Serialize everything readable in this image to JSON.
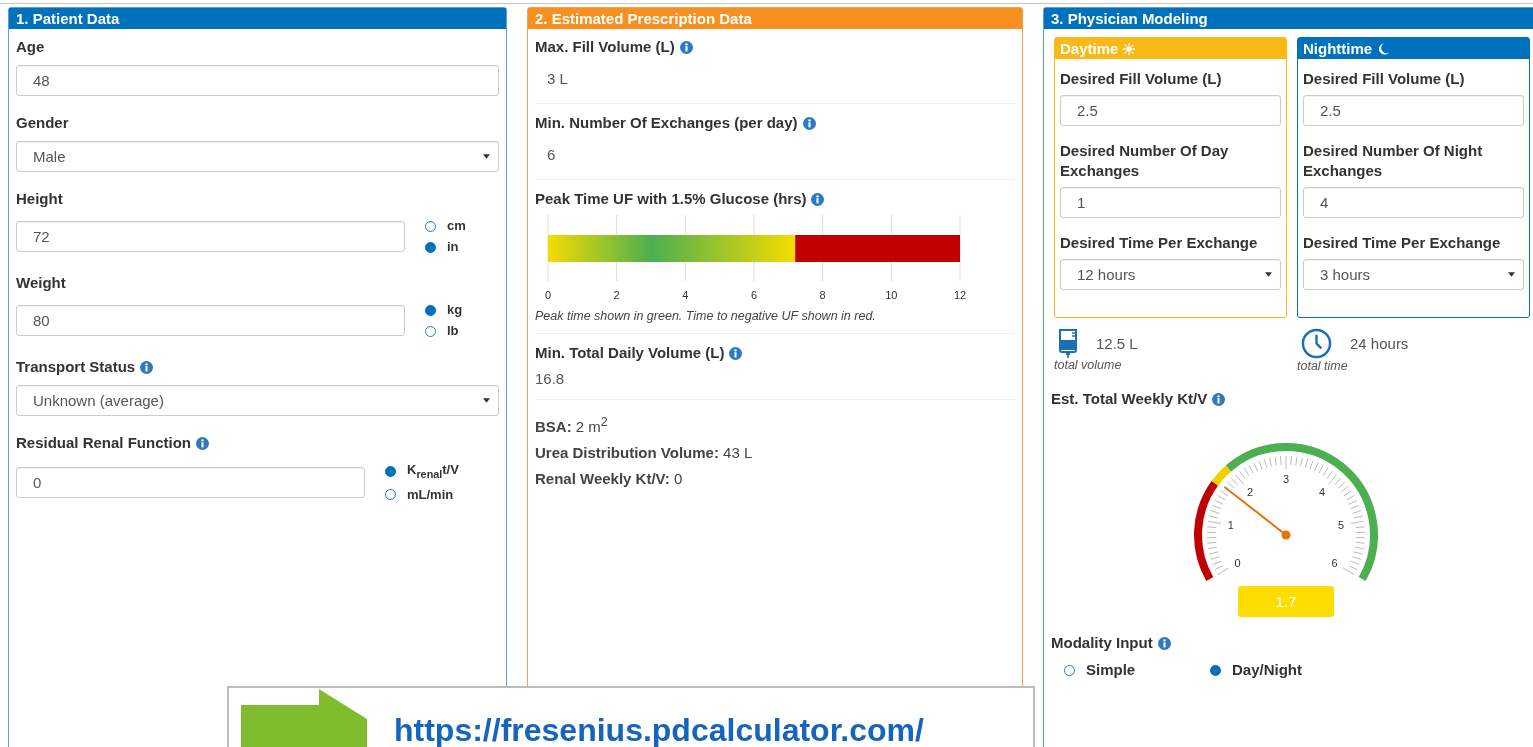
{
  "patient_data": {
    "title": "1. Patient Data",
    "fields": [
      {
        "kind": "input",
        "label": "Age",
        "info": false,
        "value": "48"
      },
      {
        "kind": "select",
        "label": "Gender",
        "info": false,
        "value": "Male"
      },
      {
        "kind": "input",
        "label": "Height",
        "info": false,
        "value": "72",
        "units": [
          {
            "label": "cm",
            "selected": false
          },
          {
            "label": "in",
            "selected": true
          }
        ]
      },
      {
        "kind": "input",
        "label": "Weight",
        "info": false,
        "value": "80",
        "units": [
          {
            "label": "kg",
            "selected": true
          },
          {
            "label": "lb",
            "selected": false
          }
        ]
      },
      {
        "kind": "select",
        "label": "Transport Status",
        "info": true,
        "value": "Unknown (average)"
      },
      {
        "kind": "input",
        "label": "Residual Renal Function",
        "info": true,
        "value": "0",
        "units": [
          {
            "label": "K$_{renal}$t/V",
            "selected": true
          },
          {
            "label": "mL/min",
            "selected": false
          }
        ]
      }
    ]
  },
  "prescription_data": {
    "title": "2. Estimated Prescription Data",
    "items": [
      {
        "kind": "value",
        "label": "Max. Fill Volume (L)",
        "info": true,
        "value": "3 L"
      },
      {
        "kind": "value",
        "label": "Min. Number Of Exchanges (per day)",
        "info": true,
        "value": "6"
      },
      {
        "kind": "chart",
        "label": "Peak Time UF with 1.5% Glucose (hrs)",
        "info": true,
        "chart_data": {
          "type": "bar",
          "orientation": "horizontal",
          "stacked": true,
          "grid": true,
          "series": [
            {
              "color": "#4caf50",
              "values": [
                7.2
              ]
            },
            {
              "color": "#c00000",
              "values": [
                4.8
              ]
            }
          ],
          "xlim": [
            0,
            12
          ],
          "xticks": [
            0,
            2,
            4,
            6,
            8,
            10,
            12
          ]
        },
        "caption": "Peak time shown in green. Time to negative UF shown in red."
      },
      {
        "kind": "total",
        "label": "Min. Total Daily Volume (L)",
        "info": true,
        "value": "16.8"
      },
      {
        "kind": "facts",
        "lines": [
          "**BSA:** 2 m$^{2}$",
          "**Urea Distribution Volume:** 43 L",
          "**Renal Weekly Kt/V:** 0"
        ]
      }
    ]
  },
  "physician_modeling": {
    "title": "3. Physician Modeling",
    "periods": [
      {
        "kind": "day",
        "title": "Daytime",
        "fields": [
          {
            "kind": "input",
            "label": "Desired Fill Volume (L)",
            "value": "2.5"
          },
          {
            "kind": "input",
            "label": "Desired Number Of Day Exchanges",
            "value": "1"
          },
          {
            "kind": "select",
            "label": "Desired Time Per Exchange",
            "value": "12 hours"
          }
        ]
      },
      {
        "kind": "night",
        "title": "Nighttime",
        "fields": [
          {
            "kind": "input",
            "label": "Desired Fill Volume (L)",
            "value": "2.5"
          },
          {
            "kind": "input",
            "label": "Desired Number Of Night Exchanges",
            "value": "4"
          },
          {
            "kind": "select",
            "label": "Desired Time Per Exchange",
            "value": "3 hours"
          }
        ]
      }
    ],
    "totals": [
      {
        "kind": "volume",
        "value": "12.5 L",
        "caption": "total volume"
      },
      {
        "kind": "time",
        "value": "24 hours",
        "caption": "total time"
      }
    ],
    "ktv": {
      "label": "Est. Total Weekly Kt/V",
      "info": true,
      "scale": [
        "0",
        "1",
        "2",
        "3",
        "4",
        "5",
        "6"
      ],
      "reading": "1.7"
    },
    "modality": {
      "label": "Modality Input",
      "info": true,
      "options": [
        {
          "label": "Simple",
          "selected": false
        },
        {
          "label": "Day/Night",
          "selected": true
        }
      ]
    }
  },
  "callout": {
    "text": "https://fresenius.pdcalculator.com/"
  }
}
